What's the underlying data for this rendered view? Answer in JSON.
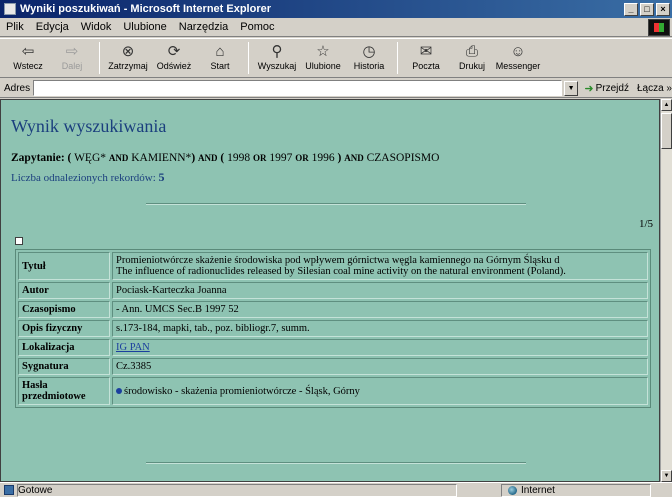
{
  "window": {
    "title": "Wyniki poszukiwań - Microsoft Internet Explorer",
    "controls": [
      "_",
      "□",
      "×"
    ]
  },
  "menu": [
    "Plik",
    "Edycja",
    "Widok",
    "Ulubione",
    "Narzędzia",
    "Pomoc"
  ],
  "toolbar": [
    {
      "label": "Wstecz",
      "icon": "back-arrow-icon",
      "glyph": "⇦",
      "enabled": true
    },
    {
      "label": "Dalej",
      "icon": "forward-arrow-icon",
      "glyph": "⇨",
      "enabled": false
    },
    {
      "label": "Zatrzymaj",
      "icon": "stop-icon",
      "glyph": "⊗",
      "enabled": true
    },
    {
      "label": "Odśwież",
      "icon": "refresh-icon",
      "glyph": "⟳",
      "enabled": true
    },
    {
      "label": "Start",
      "icon": "home-icon",
      "glyph": "⌂",
      "enabled": true
    },
    {
      "label": "Wyszukaj",
      "icon": "search-icon",
      "glyph": "⚲",
      "enabled": true
    },
    {
      "label": "Ulubione",
      "icon": "favorites-icon",
      "glyph": "☆",
      "enabled": true
    },
    {
      "label": "Historia",
      "icon": "history-icon",
      "glyph": "◷",
      "enabled": true
    },
    {
      "label": "Poczta",
      "icon": "mail-icon",
      "glyph": "✉",
      "enabled": true
    },
    {
      "label": "Drukuj",
      "icon": "print-icon",
      "glyph": "⎙",
      "enabled": true
    },
    {
      "label": "Messenger",
      "icon": "messenger-icon",
      "glyph": "☺",
      "enabled": true
    }
  ],
  "addressbar": {
    "label": "Adres",
    "value": "",
    "go_label": "Przejdź",
    "links_label": "Łącza »"
  },
  "page": {
    "title": "Wynik wyszukiwania",
    "query": {
      "label": "Zapytanie:",
      "open1": "(",
      "term1": "WĘG*",
      "and1": "AND",
      "term2": "KAMIENN*",
      "close1": ")",
      "and2": "AND",
      "open2": "(",
      "year1": "1998",
      "or1": "OR",
      "year2": "1997",
      "or2": "OR",
      "year3": "1996",
      "close2": ")",
      "and3": "AND",
      "term3": "CZASOPISMO"
    },
    "count_label": "Liczba odnalezionych rekordów:",
    "count_value": "5",
    "pager": "1/5",
    "record": [
      {
        "label": "Tytuł",
        "lines": [
          "Promieniotwórcze skażenie środowiska pod wpływem górnictwa węgla kamiennego na Górnym Śląsku d",
          "The influence of radionuclides released by Silesian coal mine activity on the natural environment (Poland)."
        ]
      },
      {
        "label": "Autor",
        "lines": [
          "Pociask-Karteczka Joanna"
        ]
      },
      {
        "label": "Czasopismo",
        "lines": [
          "- Ann. UMCS Sec.B 1997 52"
        ]
      },
      {
        "label": "Opis fizyczny",
        "lines": [
          "s.173-184, mapki, tab., poz. bibliogr.7, summ."
        ]
      },
      {
        "label": "Lokalizacja",
        "link": "IG PAN"
      },
      {
        "label": "Sygnatura",
        "lines": [
          "Cz.3385"
        ]
      },
      {
        "label": "Hasła przedmiotowe",
        "subject": "środowisko - skażenia promieniotwórcze - Śląsk, Górny"
      }
    ]
  },
  "status": {
    "text": "Gotowe",
    "zone": "Internet"
  },
  "colors": {
    "content_bg": "#8ec3b2",
    "heading": "#1b3f7e",
    "titlebar": "#0a246a"
  }
}
